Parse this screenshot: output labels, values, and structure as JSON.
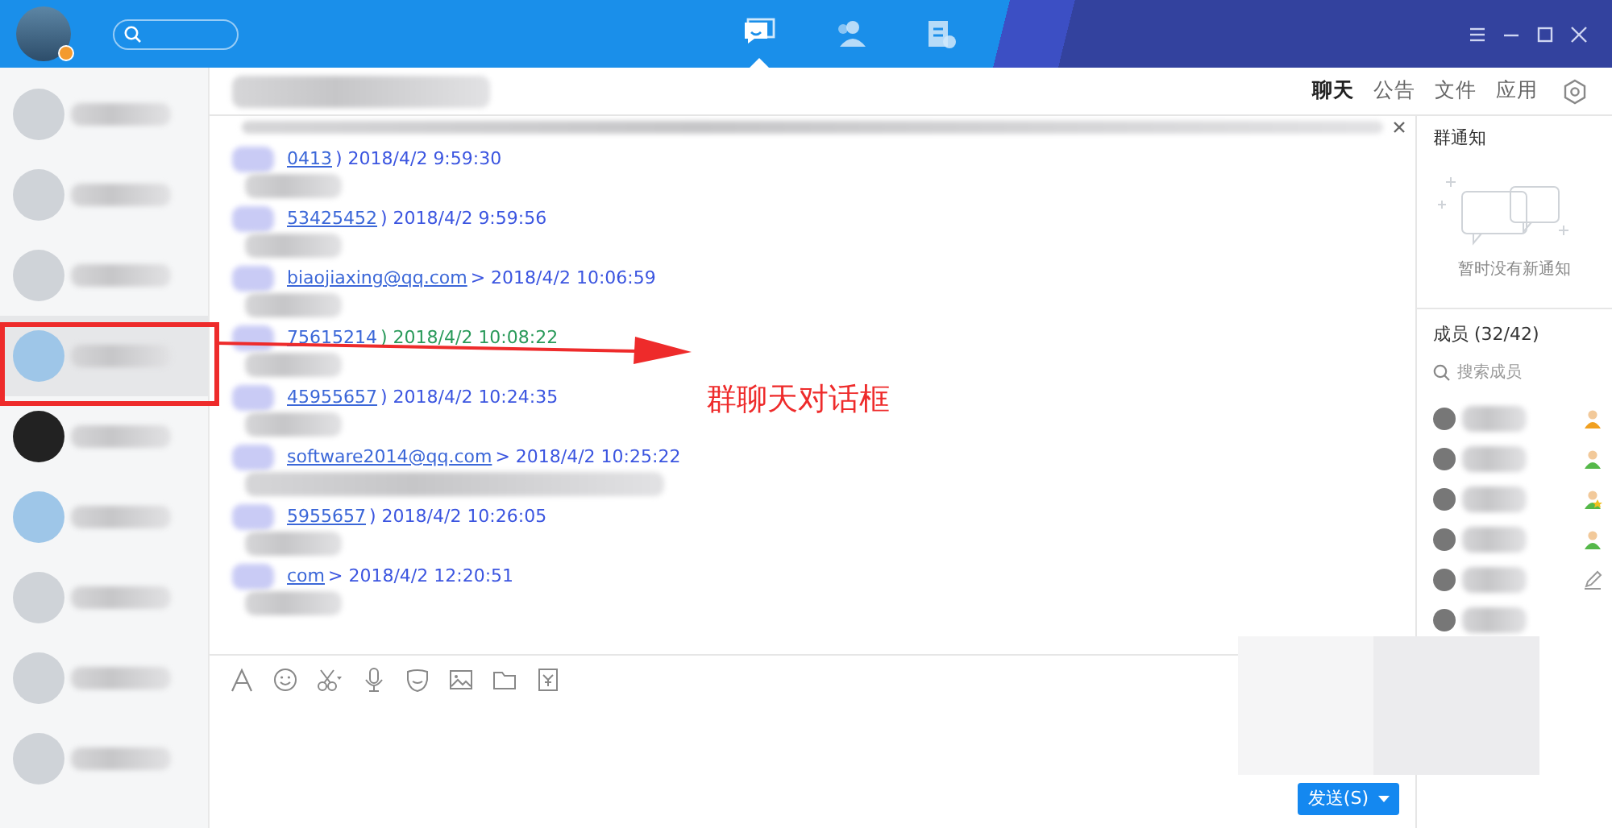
{
  "topbar": {
    "nav": [
      {
        "selected": true
      },
      {
        "selected": false
      },
      {
        "selected": false
      }
    ]
  },
  "sidebar": {
    "items": [
      {
        "selected": false
      },
      {
        "selected": false
      },
      {
        "selected": false
      },
      {
        "selected": true
      },
      {
        "selected": false
      },
      {
        "selected": false
      },
      {
        "selected": false
      },
      {
        "selected": false
      },
      {
        "selected": false
      }
    ]
  },
  "chat": {
    "tabs": [
      {
        "label": "聊天",
        "selected": true
      },
      {
        "label": "公告",
        "selected": false
      },
      {
        "label": "文件",
        "selected": false
      },
      {
        "label": "应用",
        "selected": false
      }
    ],
    "messages": [
      {
        "sender": "0413",
        "closer": ")",
        "time": "2018/4/2 9:59:30",
        "self": false
      },
      {
        "sender": "53425452",
        "closer": ")",
        "time": "2018/4/2 9:59:56",
        "self": false
      },
      {
        "sender": "biaojiaxing@qq.com",
        "closer": ">",
        "time": "2018/4/2 10:06:59",
        "self": false
      },
      {
        "sender": "75615214",
        "closer": ")",
        "time": "2018/4/2 10:08:22",
        "self": true
      },
      {
        "sender": "45955657",
        "closer": ")",
        "time": "2018/4/2 10:24:35",
        "self": false
      },
      {
        "sender": "software2014@qq.com",
        "closer": ">",
        "time": "2018/4/2 10:25:22",
        "self": false
      },
      {
        "sender": "5955657",
        "closer": ")",
        "time": "2018/4/2 10:26:05",
        "self": false
      },
      {
        "sender": "com",
        "closer": ">",
        "time": "2018/4/2 12:20:51",
        "self": false
      }
    ],
    "send_button": "发送(S)"
  },
  "group_panel": {
    "notice_title": "群通知",
    "notice_empty": "暂时没有新通知",
    "members_title": "成员 (32/42)",
    "search_placeholder": "搜索成员",
    "members": [
      {
        "kind": "owner"
      },
      {
        "kind": "member"
      },
      {
        "kind": "admin"
      },
      {
        "kind": "member"
      },
      {
        "kind": "editor"
      },
      {
        "kind": "none"
      }
    ]
  },
  "annotation": {
    "text": "群聊天对话框"
  }
}
